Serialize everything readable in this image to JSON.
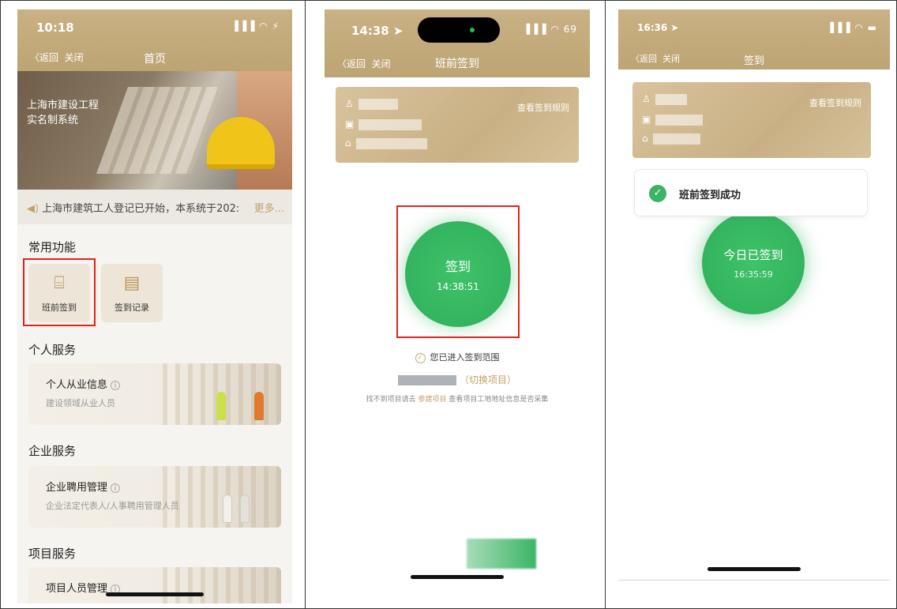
{
  "phone1": {
    "status_time": "10:18",
    "status_icons": "▐▐▐ ◠ ⚡",
    "nav": {
      "back": "〈返回",
      "close": "关闭",
      "title": "首页"
    },
    "banner_title_line1": "上海市建设工程",
    "banner_title_line2": "实名制系统",
    "notice_text": "上海市建筑工人登记已开始，本系统于202:",
    "notice_more": "更多...",
    "common_functions": {
      "title": "常用功能",
      "items": [
        {
          "label": "班前签到",
          "icon": "scan-frame-icon"
        },
        {
          "label": "签到记录",
          "icon": "calendar-check-icon"
        }
      ]
    },
    "personal_services": {
      "title": "个人服务",
      "card_title": "个人从业信息",
      "card_subtitle": "建设领域从业人员"
    },
    "enterprise_services": {
      "title": "企业服务",
      "card_title": "企业聘用管理",
      "card_subtitle": "企业法定代表人/人事聘用管理人员"
    },
    "project_services": {
      "title": "项目服务",
      "card_title": "项目人员管理"
    },
    "info_mark": "i"
  },
  "phone2": {
    "status_time": "14:38 ➤",
    "status_icons": "▐▐▐ ◠ 69",
    "nav": {
      "back": "〈返回",
      "close": "关闭",
      "title": "班前签到"
    },
    "view_rules": "查看签到规则",
    "sign_label": "签到",
    "sign_time": "14:38:51",
    "range_text": "您已进入签到范围",
    "switch_project": "（切换项目）",
    "hint_prefix": "找不到项目请去",
    "hint_link": "参建项目",
    "hint_suffix": "查看项目工地地址信息是否采集"
  },
  "phone3": {
    "status_time": "16:36 ➤",
    "status_icons": "▐▐▐ ◠ ▬",
    "nav": {
      "back": "〈返回",
      "close": "关闭",
      "title": "签到"
    },
    "view_rules": "查看签到规则",
    "toast_text": "班前签到成功",
    "signed_label": "今日已签到",
    "signed_time": "16:35:59"
  },
  "colors": {
    "gold": "#c9b184",
    "accent_gold": "#c2a266",
    "green": "#33b45e",
    "highlight_red": "#e0241b"
  }
}
